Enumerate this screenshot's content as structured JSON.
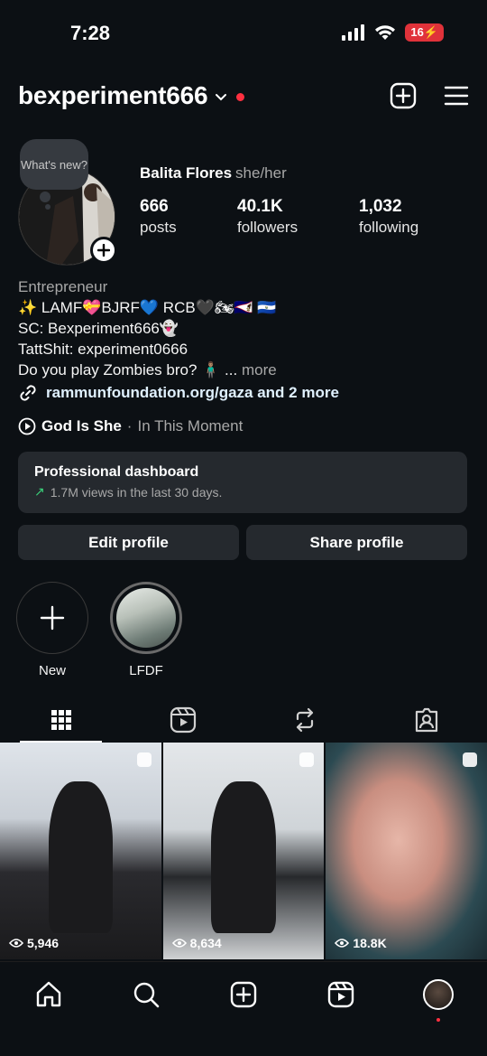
{
  "status_bar": {
    "time": "7:28",
    "battery": "16"
  },
  "header": {
    "username": "bexperiment666"
  },
  "profile": {
    "note": "What's new?",
    "full_name": "Balita Flores",
    "pronouns": "she/her",
    "stats": {
      "posts": {
        "value": "666",
        "label": "posts"
      },
      "followers": {
        "value": "40.1K",
        "label": "followers"
      },
      "following": {
        "value": "1,032",
        "label": "following"
      }
    },
    "category": "Entrepreneur",
    "bio_lines": [
      "✨ LAMF💝BJRF💙 RCB🖤🏍🇦🇸 🇸🇻",
      "SC: Bexperiment666👻",
      "TattShit: experiment0666",
      "Do you play Zombies bro? 🧍🏽‍♂️ ..."
    ],
    "more": "more",
    "link": "rammunfoundation.org/gaza and 2 more",
    "music": {
      "song": "God Is She",
      "separator": "·",
      "artist": "In This Moment"
    }
  },
  "dashboard": {
    "title": "Professional dashboard",
    "subtitle": "1.7M views in the last 30 days."
  },
  "buttons": {
    "edit": "Edit profile",
    "share": "Share profile"
  },
  "highlights": [
    {
      "label": "New"
    },
    {
      "label": "LFDF"
    }
  ],
  "grid": [
    {
      "views": "5,946"
    },
    {
      "views": "8,634"
    },
    {
      "views": "18.8K"
    }
  ],
  "icons": {
    "header": [
      "chevron-down-icon",
      "add-post-icon",
      "menu-icon"
    ],
    "tabs": [
      "grid-icon",
      "reels-icon",
      "reposts-icon",
      "tagged-icon"
    ],
    "nav": [
      "home-icon",
      "search-icon",
      "create-icon",
      "reels-icon",
      "profile-avatar"
    ]
  },
  "colors": {
    "background": "#0c1014",
    "notification": "#ff3040",
    "battery": "#e0323a",
    "trend": "#3ad17a"
  }
}
